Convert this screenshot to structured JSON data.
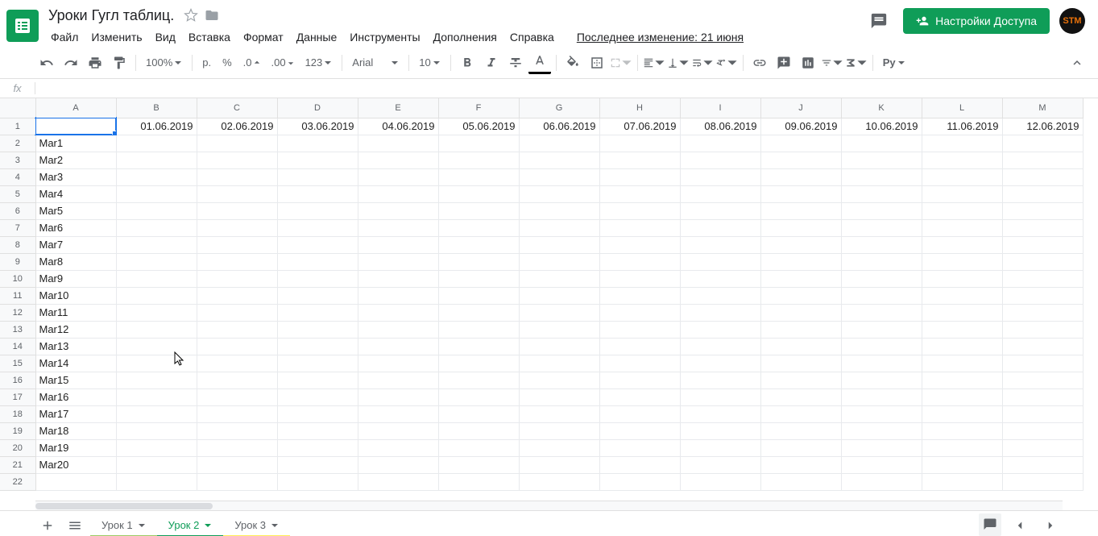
{
  "doc_title": "Уроки Гугл таблиц.",
  "menubar": [
    "Файл",
    "Изменить",
    "Вид",
    "Вставка",
    "Формат",
    "Данные",
    "Инструменты",
    "Дополнения",
    "Справка"
  ],
  "last_edit": "Последнее изменение: 21 июня",
  "share_label": "Настройки Доступа",
  "avatar": "STM",
  "toolbar": {
    "zoom": "100%",
    "currency": "р.",
    "percent": "%",
    "dec_dec": ".0",
    "inc_dec": ".00",
    "num_fmt": "123",
    "font": "Arial",
    "size": "10",
    "functions": "Рy"
  },
  "fx": "fx",
  "columns": [
    "A",
    "B",
    "C",
    "D",
    "E",
    "F",
    "G",
    "H",
    "I",
    "J",
    "K",
    "L",
    "M"
  ],
  "row_count": 22,
  "dates": [
    "01.06.2019",
    "02.06.2019",
    "03.06.2019",
    "04.06.2019",
    "05.06.2019",
    "06.06.2019",
    "07.06.2019",
    "08.06.2019",
    "09.06.2019",
    "10.06.2019",
    "11.06.2019",
    "12.06.2019"
  ],
  "colA": [
    "Mar1",
    "Mar2",
    "Mar3",
    "Mar4",
    "Mar5",
    "Mar6",
    "Mar7",
    "Mar8",
    "Mar9",
    "Mar10",
    "Mar11",
    "Mar12",
    "Mar13",
    "Mar14",
    "Mar15",
    "Mar16",
    "Mar17",
    "Mar18",
    "Mar19",
    "Mar20"
  ],
  "sheets": [
    "Урок 1",
    "Урок 2",
    "Урок 3"
  ],
  "active_sheet": 1
}
